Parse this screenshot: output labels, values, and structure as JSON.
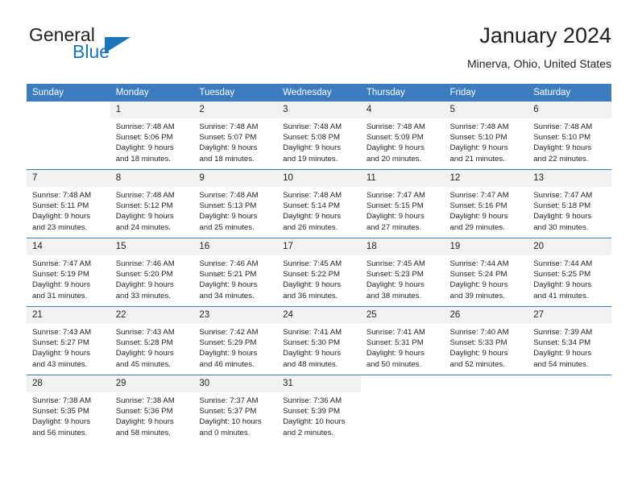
{
  "brand": {
    "name_top": "General",
    "name_bottom": "Blue",
    "triangle_icon": "blue-triangle-logo-mark",
    "accent_color": "#1b75bb"
  },
  "header": {
    "title": "January 2024",
    "subtitle": "Minerva, Ohio, United States"
  },
  "theme": {
    "header_row_bg": "#3c7cbe",
    "daynum_bg": "#f2f2f2",
    "text_color": "#231f20"
  },
  "calendar": {
    "weekday_headers": [
      "Sunday",
      "Monday",
      "Tuesday",
      "Wednesday",
      "Thursday",
      "Friday",
      "Saturday"
    ],
    "weeks": [
      [
        {
          "day": "",
          "blank": true,
          "lines": []
        },
        {
          "day": "1",
          "lines": [
            "Sunrise: 7:48 AM",
            "Sunset: 5:06 PM",
            "Daylight: 9 hours",
            "and 18 minutes."
          ]
        },
        {
          "day": "2",
          "lines": [
            "Sunrise: 7:48 AM",
            "Sunset: 5:07 PM",
            "Daylight: 9 hours",
            "and 18 minutes."
          ]
        },
        {
          "day": "3",
          "lines": [
            "Sunrise: 7:48 AM",
            "Sunset: 5:08 PM",
            "Daylight: 9 hours",
            "and 19 minutes."
          ]
        },
        {
          "day": "4",
          "lines": [
            "Sunrise: 7:48 AM",
            "Sunset: 5:09 PM",
            "Daylight: 9 hours",
            "and 20 minutes."
          ]
        },
        {
          "day": "5",
          "lines": [
            "Sunrise: 7:48 AM",
            "Sunset: 5:10 PM",
            "Daylight: 9 hours",
            "and 21 minutes."
          ]
        },
        {
          "day": "6",
          "lines": [
            "Sunrise: 7:48 AM",
            "Sunset: 5:10 PM",
            "Daylight: 9 hours",
            "and 22 minutes."
          ]
        }
      ],
      [
        {
          "day": "7",
          "lines": [
            "Sunrise: 7:48 AM",
            "Sunset: 5:11 PM",
            "Daylight: 9 hours",
            "and 23 minutes."
          ]
        },
        {
          "day": "8",
          "lines": [
            "Sunrise: 7:48 AM",
            "Sunset: 5:12 PM",
            "Daylight: 9 hours",
            "and 24 minutes."
          ]
        },
        {
          "day": "9",
          "lines": [
            "Sunrise: 7:48 AM",
            "Sunset: 5:13 PM",
            "Daylight: 9 hours",
            "and 25 minutes."
          ]
        },
        {
          "day": "10",
          "lines": [
            "Sunrise: 7:48 AM",
            "Sunset: 5:14 PM",
            "Daylight: 9 hours",
            "and 26 minutes."
          ]
        },
        {
          "day": "11",
          "lines": [
            "Sunrise: 7:47 AM",
            "Sunset: 5:15 PM",
            "Daylight: 9 hours",
            "and 27 minutes."
          ]
        },
        {
          "day": "12",
          "lines": [
            "Sunrise: 7:47 AM",
            "Sunset: 5:16 PM",
            "Daylight: 9 hours",
            "and 29 minutes."
          ]
        },
        {
          "day": "13",
          "lines": [
            "Sunrise: 7:47 AM",
            "Sunset: 5:18 PM",
            "Daylight: 9 hours",
            "and 30 minutes."
          ]
        }
      ],
      [
        {
          "day": "14",
          "lines": [
            "Sunrise: 7:47 AM",
            "Sunset: 5:19 PM",
            "Daylight: 9 hours",
            "and 31 minutes."
          ]
        },
        {
          "day": "15",
          "lines": [
            "Sunrise: 7:46 AM",
            "Sunset: 5:20 PM",
            "Daylight: 9 hours",
            "and 33 minutes."
          ]
        },
        {
          "day": "16",
          "lines": [
            "Sunrise: 7:46 AM",
            "Sunset: 5:21 PM",
            "Daylight: 9 hours",
            "and 34 minutes."
          ]
        },
        {
          "day": "17",
          "lines": [
            "Sunrise: 7:45 AM",
            "Sunset: 5:22 PM",
            "Daylight: 9 hours",
            "and 36 minutes."
          ]
        },
        {
          "day": "18",
          "lines": [
            "Sunrise: 7:45 AM",
            "Sunset: 5:23 PM",
            "Daylight: 9 hours",
            "and 38 minutes."
          ]
        },
        {
          "day": "19",
          "lines": [
            "Sunrise: 7:44 AM",
            "Sunset: 5:24 PM",
            "Daylight: 9 hours",
            "and 39 minutes."
          ]
        },
        {
          "day": "20",
          "lines": [
            "Sunrise: 7:44 AM",
            "Sunset: 5:25 PM",
            "Daylight: 9 hours",
            "and 41 minutes."
          ]
        }
      ],
      [
        {
          "day": "21",
          "lines": [
            "Sunrise: 7:43 AM",
            "Sunset: 5:27 PM",
            "Daylight: 9 hours",
            "and 43 minutes."
          ]
        },
        {
          "day": "22",
          "lines": [
            "Sunrise: 7:43 AM",
            "Sunset: 5:28 PM",
            "Daylight: 9 hours",
            "and 45 minutes."
          ]
        },
        {
          "day": "23",
          "lines": [
            "Sunrise: 7:42 AM",
            "Sunset: 5:29 PM",
            "Daylight: 9 hours",
            "and 46 minutes."
          ]
        },
        {
          "day": "24",
          "lines": [
            "Sunrise: 7:41 AM",
            "Sunset: 5:30 PM",
            "Daylight: 9 hours",
            "and 48 minutes."
          ]
        },
        {
          "day": "25",
          "lines": [
            "Sunrise: 7:41 AM",
            "Sunset: 5:31 PM",
            "Daylight: 9 hours",
            "and 50 minutes."
          ]
        },
        {
          "day": "26",
          "lines": [
            "Sunrise: 7:40 AM",
            "Sunset: 5:33 PM",
            "Daylight: 9 hours",
            "and 52 minutes."
          ]
        },
        {
          "day": "27",
          "lines": [
            "Sunrise: 7:39 AM",
            "Sunset: 5:34 PM",
            "Daylight: 9 hours",
            "and 54 minutes."
          ]
        }
      ],
      [
        {
          "day": "28",
          "lines": [
            "Sunrise: 7:38 AM",
            "Sunset: 5:35 PM",
            "Daylight: 9 hours",
            "and 56 minutes."
          ]
        },
        {
          "day": "29",
          "lines": [
            "Sunrise: 7:38 AM",
            "Sunset: 5:36 PM",
            "Daylight: 9 hours",
            "and 58 minutes."
          ]
        },
        {
          "day": "30",
          "lines": [
            "Sunrise: 7:37 AM",
            "Sunset: 5:37 PM",
            "Daylight: 10 hours",
            "and 0 minutes."
          ]
        },
        {
          "day": "31",
          "lines": [
            "Sunrise: 7:36 AM",
            "Sunset: 5:39 PM",
            "Daylight: 10 hours",
            "and 2 minutes."
          ]
        },
        {
          "day": "",
          "blank": true,
          "lines": []
        },
        {
          "day": "",
          "blank": true,
          "lines": []
        },
        {
          "day": "",
          "blank": true,
          "lines": []
        }
      ]
    ]
  }
}
